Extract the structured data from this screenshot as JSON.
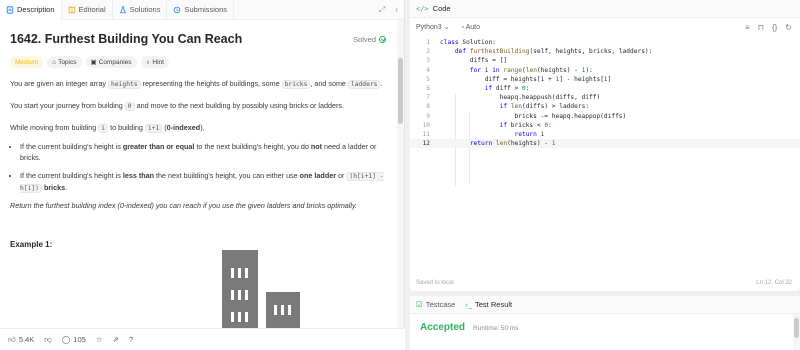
{
  "tabs": [
    {
      "label": "Description",
      "icon": "description-icon"
    },
    {
      "label": "Editorial",
      "icon": "book-icon"
    },
    {
      "label": "Solutions",
      "icon": "flask-icon"
    },
    {
      "label": "Submissions",
      "icon": "history-icon"
    }
  ],
  "problem": {
    "title": "1642. Furthest Building You Can Reach",
    "status": "Solved",
    "difficulty": "Medium",
    "chips": [
      "Topics",
      "Companies",
      "Hint"
    ],
    "p1": {
      "a": "You are given an integer array ",
      "c1": "heights",
      "b": " representing the heights of buildings, some ",
      "c2": "bricks",
      "c": ", and some ",
      "c3": "ladders",
      "d": "."
    },
    "p2": {
      "a": "You start your journey from building ",
      "c1": "0",
      "b": " and move to the next building by possibly using bricks or ladders."
    },
    "p3": {
      "a": "While moving from building ",
      "c1": "i",
      "b": " to building ",
      "c2": "i+1",
      "c": " (",
      "d": "0-indexed",
      "e": "),"
    },
    "b1": {
      "a": "If the current building's height is ",
      "s1": "greater than or equal",
      "b": " to the next building's height, you do ",
      "s2": "not",
      "c": " need a ladder or bricks."
    },
    "b2": {
      "a": "If the current building's height is ",
      "s1": "less than",
      "b": " the next building's height, you can either use ",
      "s2": "one ladder",
      "c": " or ",
      "c1": "(h[i+1] - h[i])",
      "d": " ",
      "s3": "bricks",
      "e": "."
    },
    "return_text": "Return the furthest building index (0-indexed) you can reach if you use the given ladders and bricks optimally.",
    "example_title": "Example 1:"
  },
  "footer": {
    "likes": "5.4K",
    "comments": "105"
  },
  "code": {
    "header": "Code",
    "language": "Python3",
    "mode": "Auto",
    "lines": [
      "class Solution:",
      "    def furthestBuilding(self, heights, bricks, ladders):",
      "        diffs = []",
      "        for i in range(len(heights) - 1):",
      "            diff = heights[i + 1] - heights[i]",
      "            if diff > 0:",
      "                heapq.heappush(diffs, diff)",
      "                if len(diffs) > ladders:",
      "                    bricks -= heapq.heappop(diffs)",
      "                if bricks < 0:",
      "                    return i",
      "        return len(heights) - 1"
    ],
    "saved": "Saved to local",
    "cursor": "Ln 12, Col 32"
  },
  "result": {
    "tabs": [
      "Testcase",
      "Test Result"
    ],
    "verdict": "Accepted",
    "runtime": "Runtime: 50 ms"
  },
  "colors": {
    "accent": "#2db55d",
    "medium": "#ffb800"
  }
}
